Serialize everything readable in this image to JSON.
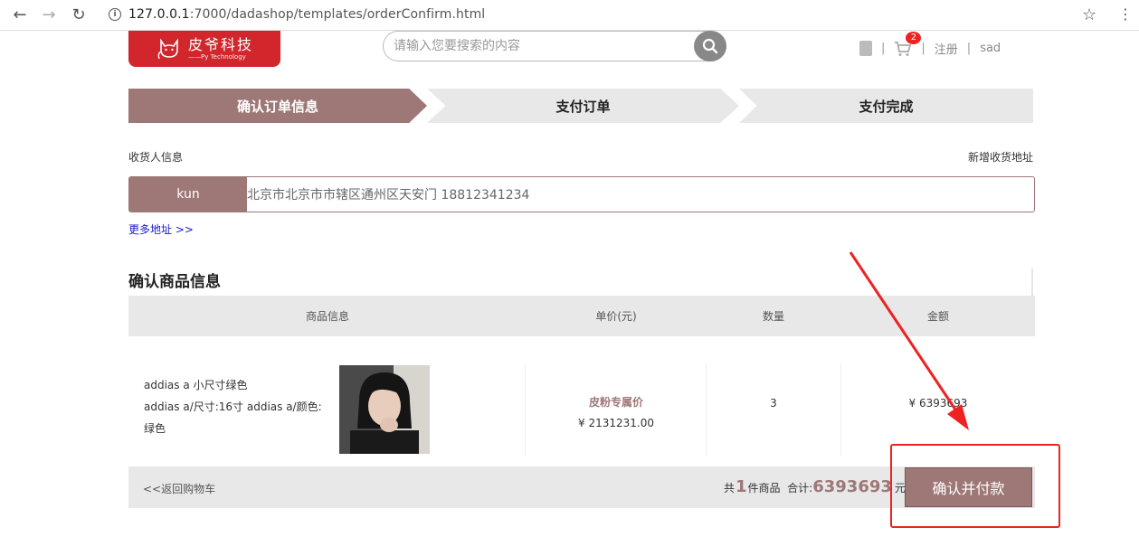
{
  "browser": {
    "url_host": "127.0.0.1",
    "url_path": ":7000/dadashop/templates/orderConfirm.html"
  },
  "header": {
    "logo_main": "皮爷科技",
    "logo_sub": "——Py Technology",
    "search_placeholder": "请输入您要搜索的内容",
    "cart_count": "2",
    "register": "注册",
    "username": "sad",
    "sep": "|"
  },
  "steps": [
    "确认订单信息",
    "支付订单",
    "支付完成"
  ],
  "address": {
    "label": "收货人信息",
    "add_new": "新增收货地址",
    "receiver": "kun",
    "detail": "北京市北京市市辖区通州区天安门  18812341234",
    "more": "更多地址 >>"
  },
  "goods": {
    "title": "确认商品信息",
    "columns": [
      "商品信息",
      "单价(元)",
      "数量",
      "金额"
    ],
    "item": {
      "name": "addias a 小尺寸绿色",
      "spec": "addias a/尺寸:16寸  addias a/颜色:",
      "spec2": "绿色",
      "price_tag": "皮粉专属价",
      "price": "¥ 2131231.00",
      "qty": "3",
      "amount": "¥ 6393693"
    }
  },
  "footer": {
    "back": "<<返回购物车",
    "count_prefix": "共",
    "count": "1",
    "count_suffix": "件商品  合计:",
    "total": "6393693",
    "unit": "元",
    "pay_button": "确认并付款"
  },
  "colors": {
    "accent": "#9e7777",
    "logo": "#d0262c",
    "annotation": "#ee2222"
  }
}
